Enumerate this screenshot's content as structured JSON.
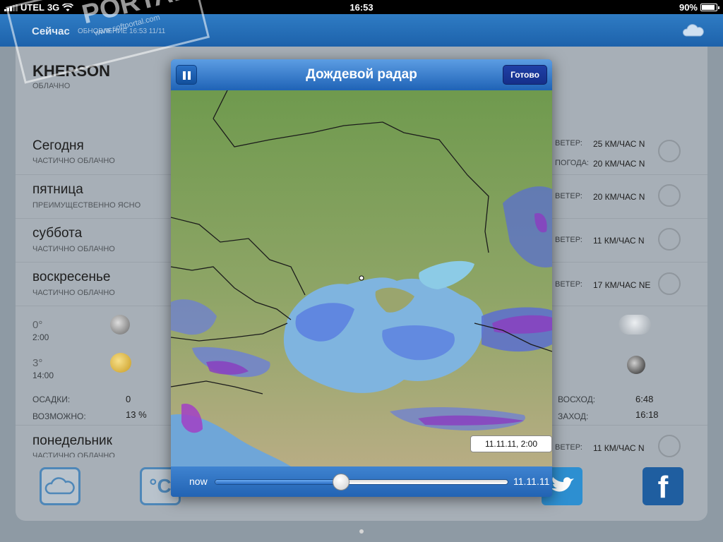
{
  "status_bar": {
    "carrier": "UTEL",
    "network": "3G",
    "time": "16:53",
    "battery": "90%"
  },
  "app_header": {
    "title": "Сейчас",
    "subtitle": "ОБНОВЛЕНИЕ 16:53 11/11"
  },
  "current": {
    "city": "KHERSON",
    "condition": "ОБЛАЧНО"
  },
  "forecast": [
    {
      "day": "Сегодня",
      "condition": "ЧАСТИЧНО ОБЛАЧНО",
      "wind_label": "ВЕТЕР:",
      "wind": "25 КМ/ЧАС N",
      "wind2_label": "ПОГОДА:",
      "wind2": "20 КМ/ЧАС N"
    },
    {
      "day": "пятница",
      "condition": "ПРЕИМУЩЕСТВЕННО ЯСНО",
      "wind_label": "ВЕТЕР:",
      "wind": "20 КМ/ЧАС N"
    },
    {
      "day": "суббота",
      "condition": "ЧАСТИЧНО ОБЛАЧНО",
      "wind_label": "ВЕТЕР:",
      "wind": "11 КМ/ЧАС N"
    },
    {
      "day": "воскресенье",
      "condition": "ЧАСТИЧНО ОБЛАЧНО",
      "wind_label": "ВЕТЕР:",
      "wind": "17 КМ/ЧАС NE"
    }
  ],
  "hourly": [
    {
      "temp": "0°",
      "time": "2:00"
    },
    {
      "temp": "3°",
      "time": "14:00"
    }
  ],
  "details": {
    "precip_label": "ОСАДКИ:",
    "precip": "0",
    "chance_label": "ВОЗМОЖНО:",
    "chance": "13 %",
    "sunrise_label": "ВОСХОД:",
    "sunrise": "6:48",
    "sunset_label": "ЗАХОД:",
    "sunset": "16:18"
  },
  "next_day": {
    "day": "понедельник",
    "condition": "ЧАСТИЧНО ОБЛАЧНО",
    "wind_label": "ВЕТЕР:",
    "wind": "11 КМ/ЧАС N"
  },
  "watermark": {
    "text": "PORTAL",
    "tm": "TM",
    "url": "www.softportal.com"
  },
  "tabbar": {
    "celsius": "°C"
  },
  "modal": {
    "title": "Дождевой радар",
    "done": "Готово",
    "timestamp": "11.11.11, 2:00",
    "slider_start": "now",
    "slider_end": "11.11.11",
    "slider_position": 0.43
  },
  "colors": {
    "header_blue": "#1f63b6",
    "done_blue": "#1f3fa6",
    "radar_light": "#7fa8e6",
    "radar_heavy": "#8a3fc0"
  }
}
